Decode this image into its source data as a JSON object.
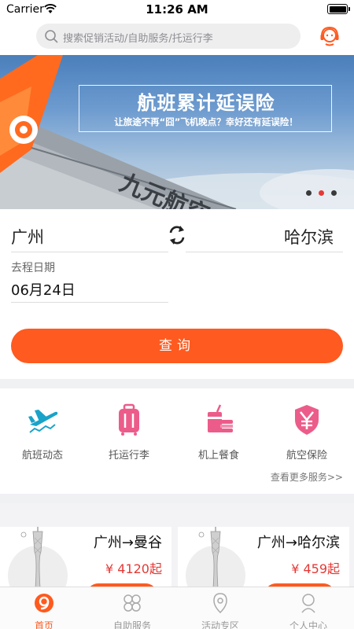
{
  "status_bar": {
    "carrier": "Carrier",
    "time": "11:26 AM"
  },
  "search": {
    "placeholder": "搜索促销活动/自助服务/托运行李"
  },
  "banner": {
    "title": "航班累计延误险",
    "subtitle": "让旅途不再“囧”飞机晚点？幸好还有延误险！",
    "fuselage_text": "九元航空",
    "page_count": 3,
    "active_page": 2
  },
  "route": {
    "from_city": "广州",
    "to_city": "哈尔滨",
    "date_label": "去程日期",
    "date_value": "06月24日",
    "query_label": "查询"
  },
  "services": {
    "items": [
      {
        "label": "航班动态",
        "icon": "plane-takeoff-icon",
        "color": "#1aa3c9"
      },
      {
        "label": "托运行李",
        "icon": "luggage-icon",
        "color": "#ec5c8a"
      },
      {
        "label": "机上餐食",
        "icon": "meal-icon",
        "color": "#ec5c8a"
      },
      {
        "label": "航空保险",
        "icon": "insurance-shield-icon",
        "color": "#ec5c8a"
      }
    ],
    "more_label": "查看更多服务>>"
  },
  "deals": [
    {
      "route": "广州→曼谷",
      "price": "¥ 4120起"
    },
    {
      "route": "广州→哈尔滨",
      "price": "¥ 459起"
    }
  ],
  "tabs": [
    {
      "label": "首页",
      "icon": "home-logo-icon",
      "active": true
    },
    {
      "label": "自助服务",
      "icon": "self-service-icon",
      "active": false
    },
    {
      "label": "活动专区",
      "icon": "events-icon",
      "active": false
    },
    {
      "label": "个人中心",
      "icon": "profile-icon",
      "active": false
    }
  ],
  "colors": {
    "accent": "#ff5a1f",
    "price": "#e53935",
    "service_blue": "#1aa3c9",
    "service_pink": "#ec5c8a"
  }
}
